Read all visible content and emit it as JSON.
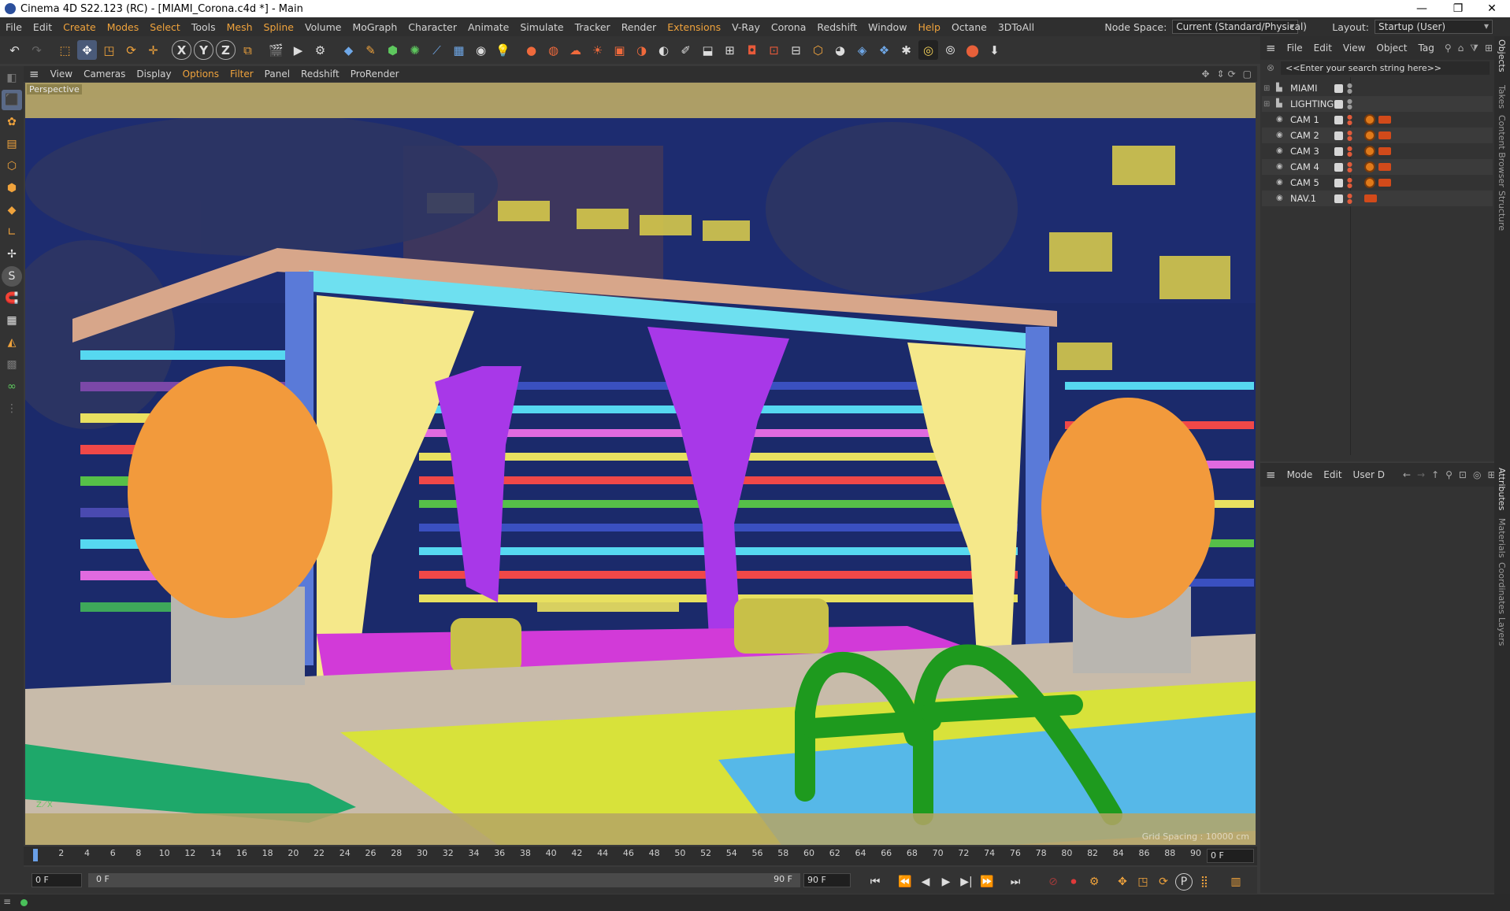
{
  "window": {
    "title": "Cinema 4D S22.123 (RC) - [MIAMI_Corona.c4d *] - Main",
    "minimize": "—",
    "maximize": "❐",
    "close": "✕"
  },
  "menubar": {
    "items": [
      "File",
      "Edit",
      "Create",
      "Modes",
      "Select",
      "Tools",
      "Mesh",
      "Spline",
      "Volume",
      "MoGraph",
      "Character",
      "Animate",
      "Simulate",
      "Tracker",
      "Render",
      "Extensions",
      "V-Ray",
      "Corona",
      "Redshift",
      "Window",
      "Help",
      "Octane",
      "3DToAll"
    ],
    "node_space_label": "Node Space:",
    "node_space_value": "Current (Standard/Physical)",
    "layout_label": "Layout:",
    "layout_value": "Startup (User)"
  },
  "viewport": {
    "menu": [
      "View",
      "Cameras",
      "Display",
      "Options",
      "Filter",
      "Panel",
      "Redshift",
      "ProRender"
    ],
    "label": "Perspective",
    "grid_spacing": "Grid Spacing : 10000 cm"
  },
  "objects": {
    "menu": [
      "File",
      "Edit",
      "View",
      "Object",
      "Tag"
    ],
    "search_placeholder": "<<Enter your search string here>>",
    "rows": [
      {
        "name": "MIAMI",
        "type": "layer"
      },
      {
        "name": "LIGHTING",
        "type": "layer"
      },
      {
        "name": "CAM 1",
        "type": "camera"
      },
      {
        "name": "CAM 2",
        "type": "camera"
      },
      {
        "name": "CAM 3",
        "type": "camera"
      },
      {
        "name": "CAM 4",
        "type": "camera"
      },
      {
        "name": "CAM 5",
        "type": "camera"
      },
      {
        "name": "NAV.1",
        "type": "camera"
      }
    ]
  },
  "attributes": {
    "menu": [
      "Mode",
      "Edit",
      "User D"
    ]
  },
  "right_tabs": [
    "Objects",
    "Takes",
    "Content Browser",
    "Structure",
    "Attributes",
    "Materials",
    "Coordinates",
    "Layers"
  ],
  "timeline": {
    "ticks": [
      "0",
      "2",
      "4",
      "6",
      "8",
      "10",
      "12",
      "14",
      "16",
      "18",
      "20",
      "22",
      "24",
      "26",
      "28",
      "30",
      "32",
      "34",
      "36",
      "38",
      "40",
      "42",
      "44",
      "46",
      "48",
      "50",
      "52",
      "54",
      "56",
      "58",
      "60",
      "62",
      "64",
      "66",
      "68",
      "70",
      "72",
      "74",
      "76",
      "78",
      "80",
      "82",
      "84",
      "86",
      "88",
      "90"
    ],
    "current_frame": "0 F"
  },
  "transport": {
    "start": "0 F",
    "range_start": "0 F",
    "range_end": "90 F",
    "end": "90 F"
  },
  "colors": {
    "accent": "#f0a33c",
    "panel": "#333333",
    "viewport_sky": "#1a2a6a"
  }
}
